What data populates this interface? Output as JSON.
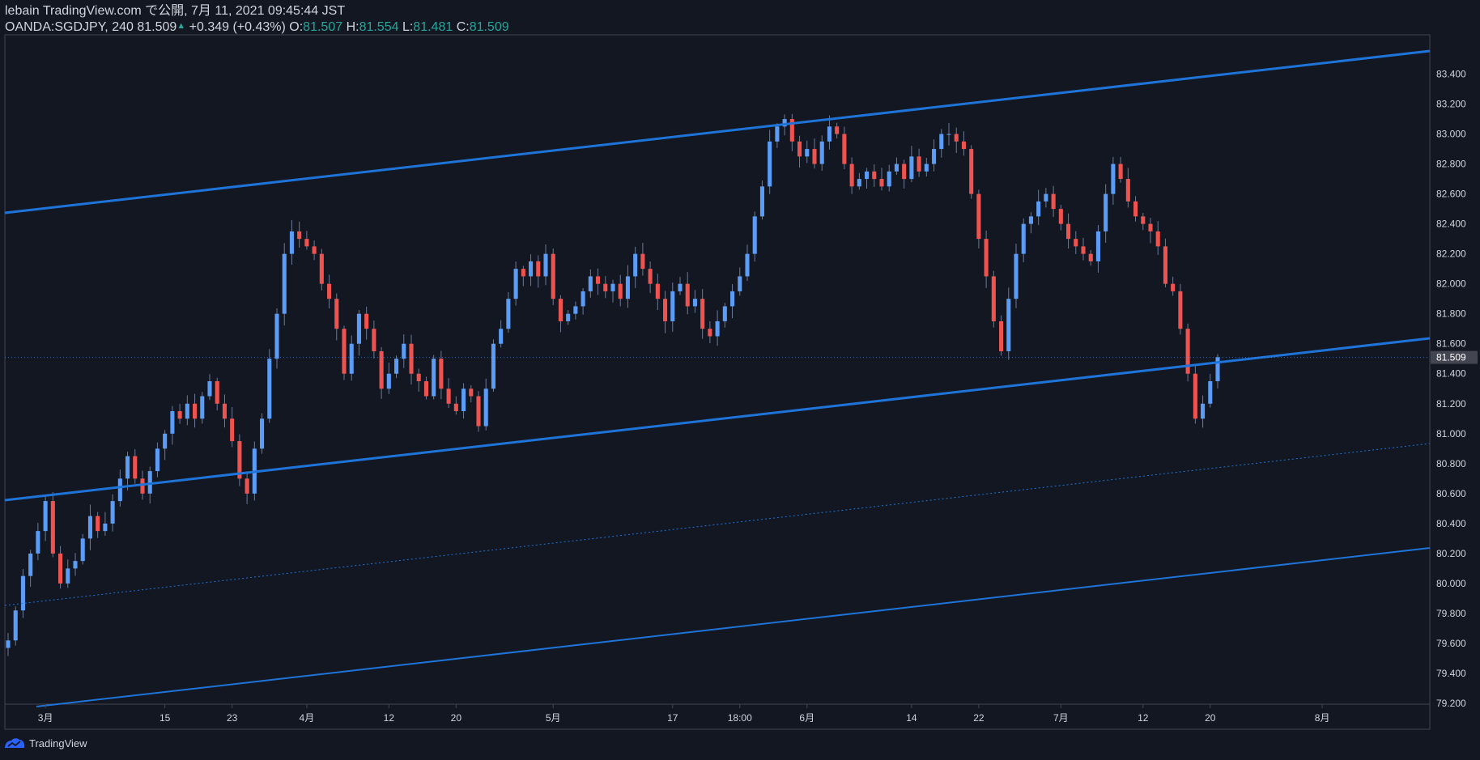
{
  "header": {
    "publisher": "lebain TradingView.com で公開, 7月 11, 2021 09:45:44 JST",
    "symbol": "OANDA:SGDJPY, 240",
    "last": "81.509",
    "change_arrow": "▲",
    "change": "+0.349 (+0.43%)",
    "o_label": "O:",
    "o_value": "81.507",
    "h_label": "H:",
    "h_value": "81.554",
    "l_label": "L:",
    "l_value": "81.481",
    "c_label": "C:",
    "c_value": "81.509"
  },
  "footer": {
    "brand": "TradingView",
    "logo_icon": "tradingview-logo-icon"
  },
  "colors": {
    "background": "#131722",
    "up": "#5b9cf6",
    "down": "#ef5350",
    "channel": "#1e74d8",
    "axis_text": "#d1d4dc",
    "price_label_bg": "#434651"
  },
  "chart_data": {
    "type": "candlestick",
    "symbol": "OANDA:SGDJPY",
    "interval": "240",
    "ylim": [
      79.2,
      83.5
    ],
    "y_ticks": [
      "83.400",
      "83.200",
      "83.000",
      "82.800",
      "82.600",
      "82.400",
      "82.200",
      "82.000",
      "81.800",
      "81.600",
      "81.400",
      "81.200",
      "81.000",
      "80.800",
      "80.600",
      "80.400",
      "80.200",
      "80.000",
      "79.800",
      "79.600",
      "79.400",
      "79.200"
    ],
    "x_ticks": [
      "3月",
      "15",
      "23",
      "4月",
      "12",
      "20",
      "5月",
      "17",
      "18:00",
      "6月",
      "14",
      "22",
      "7月",
      "12",
      "20",
      "8月"
    ],
    "x_tick_index": [
      5,
      21,
      30,
      40,
      51,
      60,
      73,
      89,
      98,
      107,
      121,
      130,
      141,
      152,
      161,
      176
    ],
    "last_price_label": "81.509",
    "close": [
      79.62,
      79.82,
      80.05,
      80.2,
      80.35,
      80.55,
      80.2,
      80.0,
      80.1,
      80.15,
      80.3,
      80.45,
      80.35,
      80.4,
      80.55,
      80.7,
      80.85,
      80.7,
      80.6,
      80.75,
      80.9,
      81.0,
      81.15,
      81.1,
      81.2,
      81.1,
      81.25,
      81.35,
      81.2,
      81.1,
      80.95,
      80.7,
      80.6,
      80.9,
      81.1,
      81.5,
      81.8,
      82.2,
      82.35,
      82.3,
      82.25,
      82.2,
      82.0,
      81.9,
      81.7,
      81.4,
      81.6,
      81.8,
      81.7,
      81.55,
      81.3,
      81.4,
      81.5,
      81.6,
      81.4,
      81.35,
      81.25,
      81.5,
      81.3,
      81.2,
      81.15,
      81.3,
      81.25,
      81.05,
      81.3,
      81.6,
      81.7,
      81.9,
      82.1,
      82.05,
      82.15,
      82.05,
      82.2,
      81.9,
      81.75,
      81.8,
      81.85,
      81.95,
      82.05,
      82.0,
      81.95,
      82.0,
      81.9,
      82.05,
      82.2,
      82.1,
      82.0,
      81.9,
      81.75,
      81.95,
      82.0,
      81.85,
      81.9,
      81.7,
      81.65,
      81.75,
      81.85,
      81.95,
      82.05,
      82.2,
      82.45,
      82.65,
      82.95,
      83.05,
      83.1,
      82.95,
      82.85,
      82.9,
      82.8,
      82.95,
      83.05,
      83.0,
      82.8,
      82.65,
      82.7,
      82.75,
      82.7,
      82.65,
      82.75,
      82.8,
      82.7,
      82.85,
      82.75,
      82.8,
      82.9,
      83.0,
      83.0,
      82.95,
      82.9,
      82.6,
      82.3,
      82.05,
      81.75,
      81.55,
      81.9,
      82.2,
      82.4,
      82.45,
      82.55,
      82.6,
      82.5,
      82.4,
      82.3,
      82.25,
      82.2,
      82.15,
      82.35,
      82.6,
      82.8,
      82.7,
      82.55,
      82.45,
      82.4,
      82.35,
      82.25,
      82.0,
      81.95,
      81.7,
      81.4,
      81.1,
      81.2,
      81.35,
      81.51
    ]
  }
}
